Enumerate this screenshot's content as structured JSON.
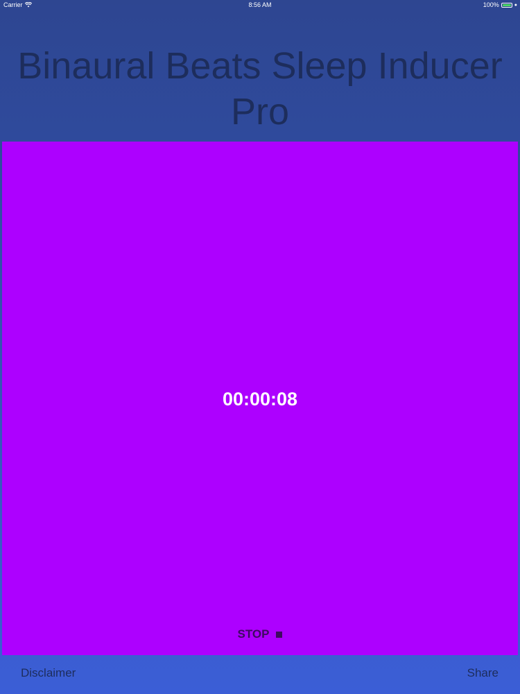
{
  "status_bar": {
    "carrier": "Carrier",
    "time": "8:56 AM",
    "battery": "100%"
  },
  "app": {
    "title": "Binaural Beats Sleep Inducer Pro"
  },
  "player": {
    "timer": "00:00:08",
    "stop_label": "STOP"
  },
  "footer": {
    "disclaimer_label": "Disclaimer",
    "share_label": "Share"
  },
  "colors": {
    "panel": "#ad00ff",
    "background": "#3150a6",
    "title_text": "#1d2d5c",
    "battery": "#4cd964"
  },
  "icons": {
    "wifi": "wifi-icon",
    "battery": "battery-icon",
    "charge": "charge-icon",
    "stop": "stop-icon"
  }
}
